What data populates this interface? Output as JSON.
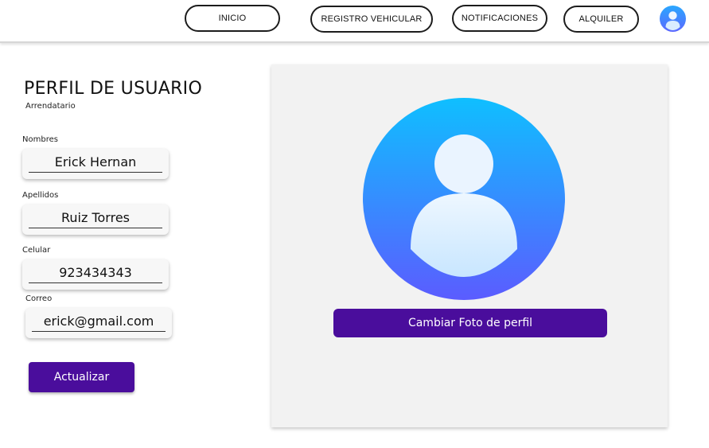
{
  "nav": {
    "inicio": "INICIO",
    "registro": "REGISTRO VEHICULAR",
    "notificaciones": "NOTIFICACIONES",
    "alquiler": "ALQUILER",
    "avatar_icon": "user-avatar-icon"
  },
  "profile": {
    "title": "PERFIL DE USUARIO",
    "role": "Arrendatario"
  },
  "form": {
    "nombres": {
      "label": "Nombres",
      "value": "Erick Hernan"
    },
    "apellidos": {
      "label": "Apellidos",
      "value": "Ruiz Torres"
    },
    "celular": {
      "label": "Celular",
      "value": "923434343"
    },
    "correo": {
      "label": "Correo",
      "value": "erick@gmail.com"
    },
    "submit_label": "Actualizar"
  },
  "photo": {
    "icon": "user-avatar-icon",
    "change_label": "Cambiar Foto de perfil"
  },
  "colors": {
    "accent": "#4a0d9c",
    "avatar_gradient_top": "#0fbfff",
    "avatar_gradient_bottom": "#5b5cff"
  }
}
